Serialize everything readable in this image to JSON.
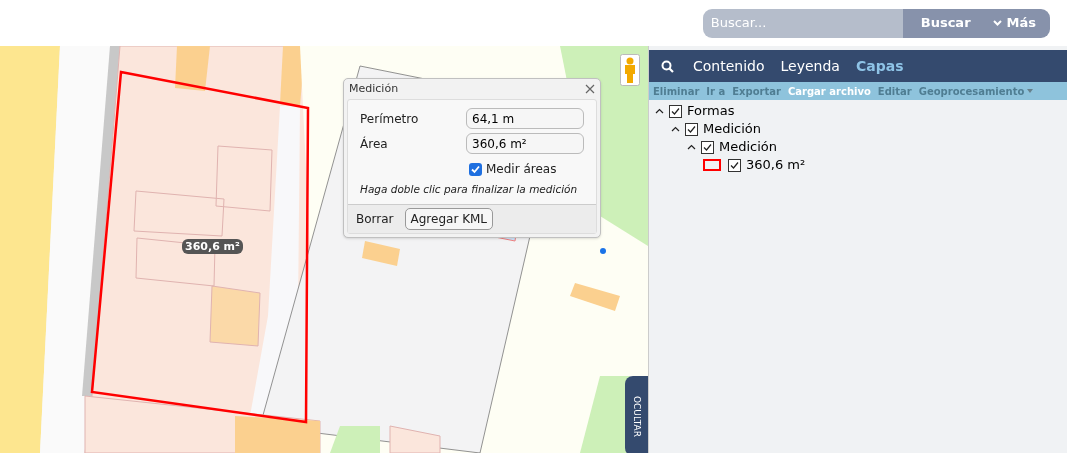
{
  "search": {
    "placeholder": "Buscar...",
    "button": "Buscar",
    "more": "Más"
  },
  "map": {
    "area_label": "360,6 m²",
    "hide_tab": "OCULTAR"
  },
  "dialog": {
    "title": "Medición",
    "fields": [
      {
        "label": "Perímetro",
        "value": "64,1 m"
      },
      {
        "label": "Área",
        "value": "360,6 m²"
      }
    ],
    "option": {
      "label": "Medir áreas",
      "checked": true
    },
    "hint": "Haga doble clic para finalizar la medición",
    "buttons": [
      {
        "label": "Borrar",
        "kind": "plain"
      },
      {
        "label": "Agregar KML",
        "kind": "raised"
      }
    ]
  },
  "panel": {
    "tabs": [
      {
        "label": "Contenido",
        "selected": false
      },
      {
        "label": "Leyenda",
        "selected": false
      },
      {
        "label": "Capas",
        "selected": true
      }
    ],
    "toolbar": [
      {
        "label": "Eliminar",
        "disabled": true
      },
      {
        "label": "Ir a",
        "disabled": true
      },
      {
        "label": "Exportar",
        "disabled": true
      },
      {
        "label": "Cargar archivo",
        "disabled": false
      },
      {
        "label": "Editar",
        "disabled": true
      },
      {
        "label": "Geoprocesamiento",
        "disabled": true,
        "kind": "dropdown"
      }
    ],
    "layers": [
      {
        "label": "Formas",
        "checked": true,
        "expanded": true,
        "children": [
          {
            "label": "Medición",
            "checked": true,
            "expanded": true,
            "children": [
              {
                "label": "Medición",
                "checked": true,
                "expanded": true,
                "children": [
                  {
                    "label": "360,6 m²",
                    "checked": true,
                    "color": "#ff0000"
                  }
                ]
              }
            ]
          }
        ]
      }
    ]
  }
}
